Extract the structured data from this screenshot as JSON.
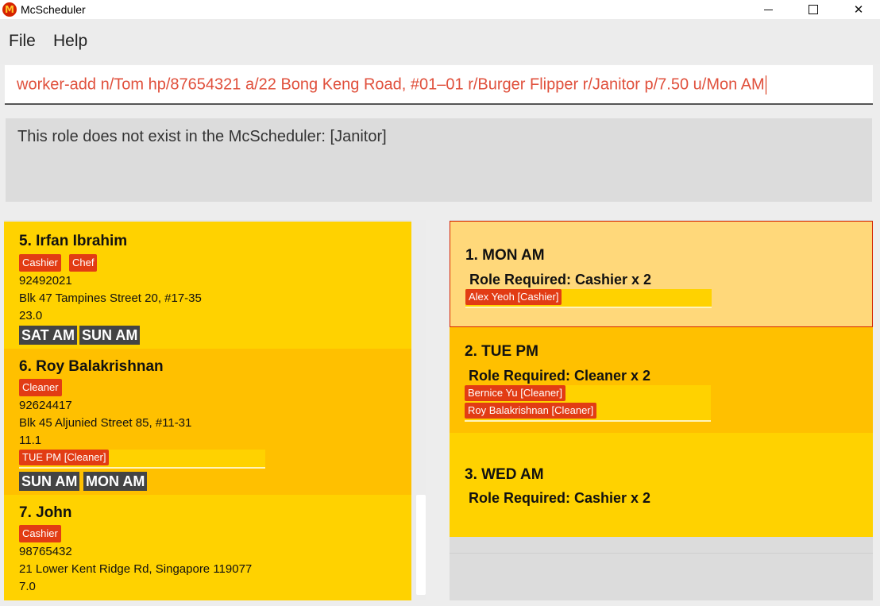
{
  "window": {
    "title": "McScheduler",
    "icon": "mcdonalds-logo-icon",
    "logo_text": "M",
    "close_glyph": "✕"
  },
  "menu": {
    "file": "File",
    "help": "Help"
  },
  "command": {
    "value": "worker-add n/Tom hp/87654321 a/22 Bong Keng Road, #01–01 r/Burger Flipper r/Janitor p/7.50 u/Mon AM"
  },
  "result": {
    "message": "This role does not exist in the McScheduler: [Janitor]"
  },
  "workers": [
    {
      "title": "5.  Irfan Ibrahim",
      "roles": [
        "Cashier",
        "Chef"
      ],
      "phone": "92492021",
      "address": "Blk 47 Tampines Street 20, #17-35",
      "pay": "23.0",
      "assignments": [],
      "unavailability": [
        "SAT AM",
        "SUN AM"
      ]
    },
    {
      "title": "6.  Roy Balakrishnan",
      "roles": [
        "Cleaner"
      ],
      "phone": "92624417",
      "address": "Blk 45 Aljunied Street 85, #11-31",
      "pay": "11.1",
      "assignments": [
        "TUE PM [Cleaner]"
      ],
      "unavailability": [
        "SUN AM",
        "MON AM"
      ]
    },
    {
      "title": "7.  John",
      "roles": [
        "Cashier"
      ],
      "phone": "98765432",
      "address": "21 Lower Kent Ridge Rd, Singapore 119077",
      "pay": "7.0",
      "assignments": [],
      "unavailability": []
    }
  ],
  "shifts": [
    {
      "title": "1.  MON AM",
      "role_required": "Role Required: Cashier x 2",
      "assignments": [
        "Alex Yeoh [Cashier]"
      ],
      "selected": true
    },
    {
      "title": "2.  TUE PM",
      "role_required": "Role Required: Cleaner x 2",
      "assignments": [
        "Bernice Yu [Cleaner]",
        "Roy Balakrishnan [Cleaner]"
      ],
      "selected": false
    },
    {
      "title": "3.  WED AM",
      "role_required": "Role Required: Cashier x 2",
      "assignments": [],
      "selected": false
    }
  ],
  "colors": {
    "brand_red": "#d62300",
    "card_yellow": "#ffd200",
    "card_amber": "#ffc000",
    "selected_card": "#ffd87a",
    "error_text": "#e0503c",
    "unavailability_tag": "#444444"
  }
}
